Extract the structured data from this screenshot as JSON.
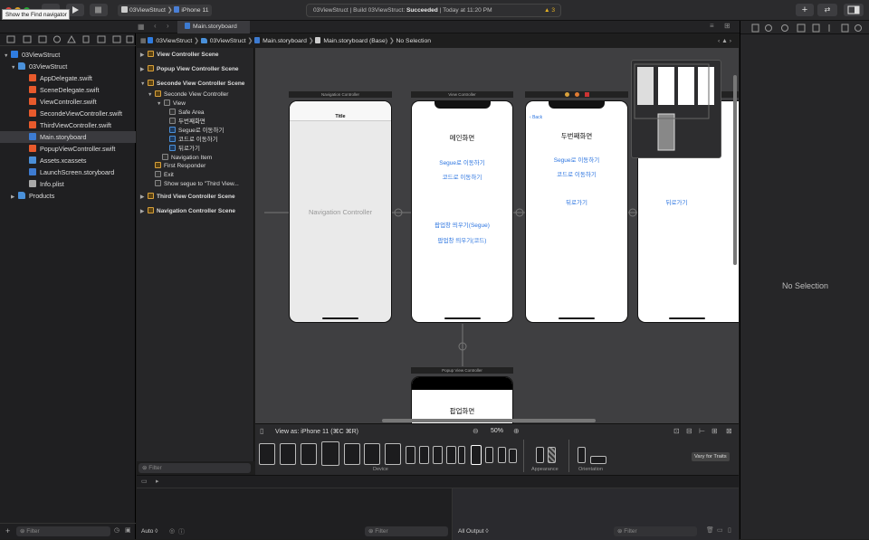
{
  "toolbar": {
    "scheme": "03ViewStruct",
    "device": "iPhone 11",
    "status_prefix": "03ViewStruct | Build 03ViewStruct: ",
    "status_result": "Succeeded",
    "status_time": " | Today at 11:20 PM",
    "warning_count": "3",
    "tooltip": "Show the Find navigator"
  },
  "tab": {
    "label": "Main.storyboard"
  },
  "navigator": {
    "items": [
      {
        "label": "03ViewStruct",
        "type": "proj"
      },
      {
        "label": "03ViewStruct",
        "type": "folder"
      },
      {
        "label": "AppDelegate.swift",
        "type": "swift"
      },
      {
        "label": "SceneDelegate.swift",
        "type": "swift"
      },
      {
        "label": "ViewController.swift",
        "type": "swift"
      },
      {
        "label": "SecondeViewController.swift",
        "type": "swift"
      },
      {
        "label": "ThirdViewController.swift",
        "type": "swift"
      },
      {
        "label": "Main.storyboard",
        "type": "sb"
      },
      {
        "label": "PopupViewController.swift",
        "type": "swift"
      },
      {
        "label": "Assets.xcassets",
        "type": "assets"
      },
      {
        "label": "LaunchScreen.storyboard",
        "type": "sb"
      },
      {
        "label": "Info.plist",
        "type": "plist"
      },
      {
        "label": "Products",
        "type": "folder"
      }
    ],
    "filter_placeholder": "Filter"
  },
  "breadcrumb": [
    "03ViewStruct",
    "03ViewStruct",
    "Main.storyboard",
    "Main.storyboard (Base)",
    "No Selection"
  ],
  "outline": {
    "items": [
      {
        "label": "View Controller Scene",
        "bold": true
      },
      {
        "label": "Popup View Controller Scene",
        "bold": true
      },
      {
        "label": "Seconde View Controller Scene",
        "bold": true
      },
      {
        "label": "Seconde View Controller",
        "bold": false
      },
      {
        "label": "View",
        "bold": false
      },
      {
        "label": "Safe Area",
        "bold": false
      },
      {
        "label": "두번째화면",
        "bold": false
      },
      {
        "label": "Segue로 이동하기",
        "bold": false
      },
      {
        "label": "코드로 이동하기",
        "bold": false
      },
      {
        "label": "뒤로가기",
        "bold": false
      },
      {
        "label": "Navigation Item",
        "bold": false
      },
      {
        "label": "First Responder",
        "bold": false
      },
      {
        "label": "Exit",
        "bold": false
      },
      {
        "label": "Show segue to \"Third View...",
        "bold": false
      },
      {
        "label": "Third View Controller Scene",
        "bold": true
      },
      {
        "label": "Navigation Controller Scene",
        "bold": true
      }
    ],
    "filter_placeholder": "Filter"
  },
  "canvas": {
    "nav_controller": {
      "header": "Navigation Controller",
      "title": "Title",
      "center": "Navigation Controller"
    },
    "view_controller": {
      "header": "View Controller",
      "title": "메인화면",
      "links": [
        "Segue로 이동하기",
        "코드로 이동하기",
        "팝업창 띄우기(Segue)",
        "팝업창 띄우기(코드)"
      ]
    },
    "second": {
      "back": "Back",
      "title": "두번째화면",
      "links": [
        "Segue로 이동하기",
        "코드로 이동하기",
        "뒤로가기"
      ]
    },
    "third": {
      "links": [
        "뒤로가기"
      ]
    },
    "popup": {
      "header": "Popup View Controller",
      "title": "팝업화면"
    }
  },
  "bottom": {
    "view_as": "View as: iPhone 11 (",
    "view_as_keys": "⌘C ⌘R",
    "view_as_end": ")",
    "zoom": "50%",
    "device_label": "Device",
    "appearance_label": "Appearance",
    "orientation_label": "Orientation",
    "vary_button": "Vary for Traits"
  },
  "debug": {
    "auto": "Auto ◊",
    "all_output": "All Output ◊",
    "filter_placeholder": "Filter"
  },
  "inspector": {
    "no_selection": "No Selection"
  }
}
